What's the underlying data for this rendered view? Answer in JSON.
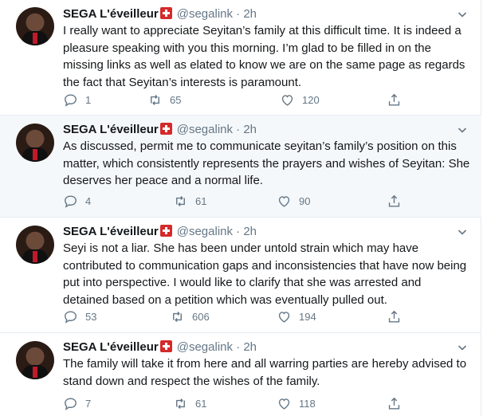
{
  "author": {
    "name": "SEGA L'éveilleur",
    "handle": "@segalink",
    "time": "2h",
    "dot": "·",
    "badge_icon": "red-cross-emoji",
    "avatar_description": "profile photo"
  },
  "tweets": [
    {
      "text": "I really want to appreciate Seyitan’s family at this difficult time. It is indeed a pleasure speaking with you this morning. I’m glad to be filled in on the missing links as well as elated to know we are on the same page as regards the fact that Seyitan’s interests is paramount.",
      "replies": "1",
      "retweets": "65",
      "likes": "120"
    },
    {
      "text": "As discussed, permit me to communicate seyitan’s family’s position on this matter, which consistently represents the prayers and wishes of Seyitan: She deserves her peace and a normal life.",
      "replies": "4",
      "retweets": "61",
      "likes": "90"
    },
    {
      "text": "Seyi is not a liar. She has been under untold strain which may have contributed to communication gaps and inconsistencies that have now being put into perspective. I would like to clarify that she was arrested and detained based on a petition which was eventually pulled out.",
      "replies": "53",
      "retweets": "606",
      "likes": "194"
    },
    {
      "text": "The family will take it from here and all warring parties are hereby advised to stand down and respect the wishes of the family.",
      "replies": "7",
      "retweets": "61",
      "likes": "118"
    }
  ],
  "colors": {
    "text": "#14171a",
    "secondary": "#657786",
    "highlight_bg": "#f5f8fa",
    "border": "#e6ecf0",
    "badge": "#d42a2a"
  }
}
